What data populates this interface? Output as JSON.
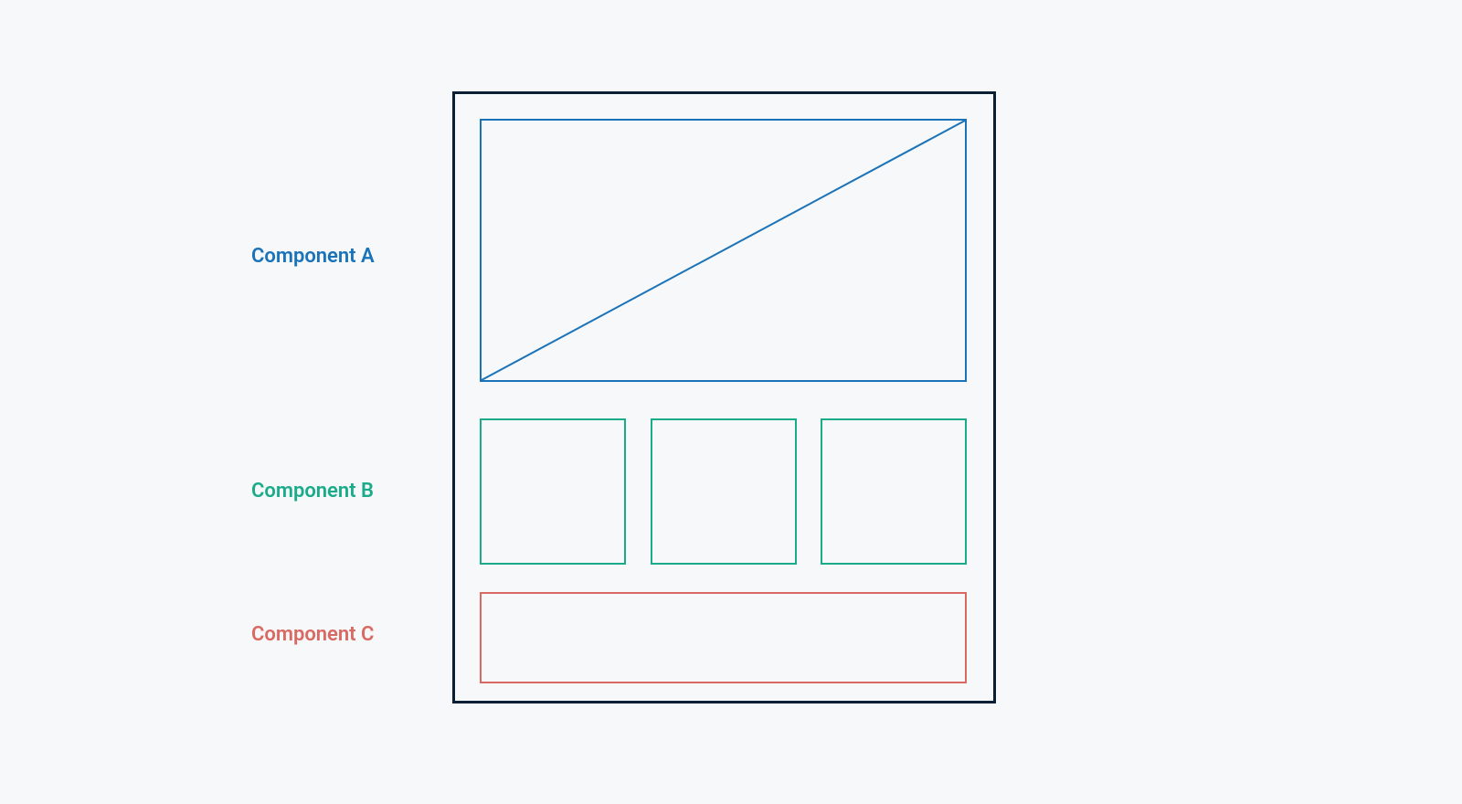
{
  "labels": {
    "componentA": "Component A",
    "componentB": "Component B",
    "componentC": "Component C"
  },
  "colors": {
    "componentA": "#1a73b8",
    "componentB": "#1aab8a",
    "componentC": "#d96a63",
    "frame": "#0a1f33",
    "background": "#f6f8f9"
  },
  "structure": {
    "componentA": {
      "shape": "rectangle-with-diagonal",
      "count": 1
    },
    "componentB": {
      "shape": "square",
      "count": 3
    },
    "componentC": {
      "shape": "rectangle",
      "count": 1
    }
  }
}
